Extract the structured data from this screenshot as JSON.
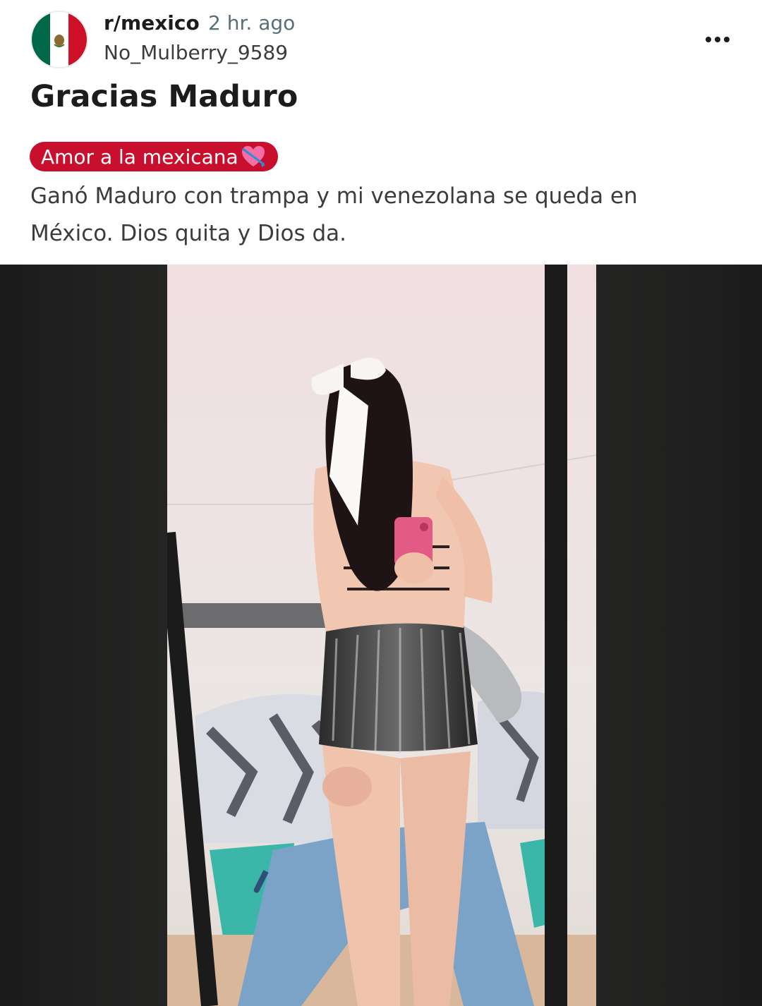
{
  "post": {
    "subreddit": "r/mexico",
    "time_ago": "2 hr. ago",
    "username": "No_Mulberry_9589",
    "title": "Gracias Maduro",
    "flair": "Amor a la mexicana",
    "body_line1": "Ganó Maduro con trampa y mi venezolana se queda en",
    "body_line2": "México. Dios quita y Dios da."
  },
  "icons": {
    "avatar": "mexico-flag-icon",
    "menu": "more-options-icon",
    "flair_emoji": "heart-with-arrow-icon"
  },
  "colors": {
    "flair_bg": "#c8102e",
    "flag_green": "#006847",
    "flag_red": "#ce1126"
  }
}
